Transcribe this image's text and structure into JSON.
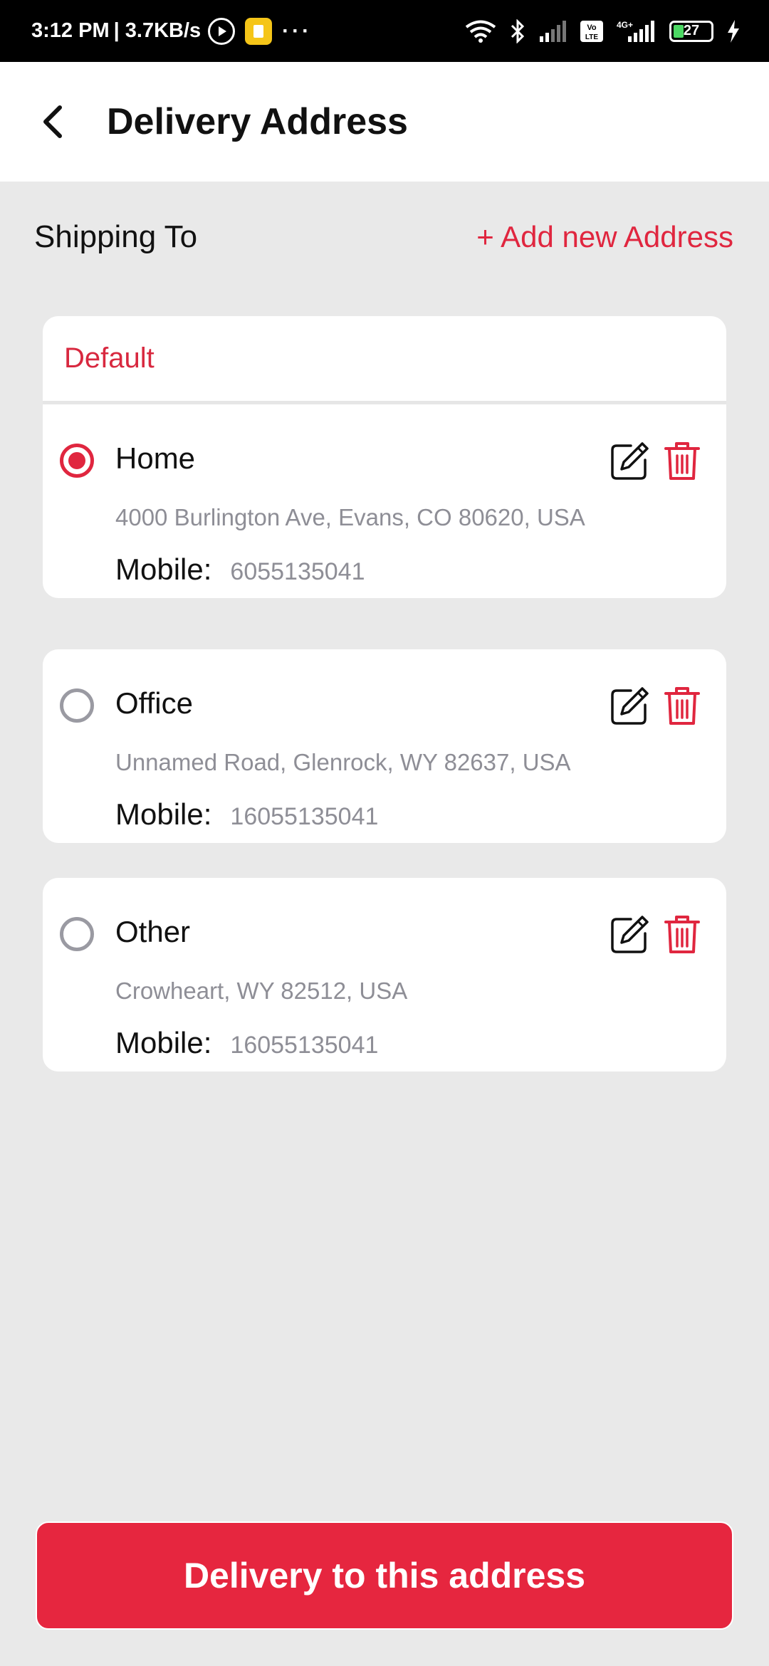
{
  "status_bar": {
    "time": "3:12 PM",
    "speed": "| 3.7KB/s",
    "dots": "···",
    "battery_level": "27",
    "icons": [
      "play-icon",
      "app-notification-icon",
      "wifi-icon",
      "bluetooth-icon",
      "signal-icon",
      "volte-icon",
      "4g-signal-icon",
      "battery-icon",
      "charging-icon"
    ]
  },
  "header": {
    "title": "Delivery Address"
  },
  "shipping": {
    "label": "Shipping To",
    "add_link": "+ Add new Address"
  },
  "default_label": "Default",
  "mobile_label": "Mobile:",
  "addresses": [
    {
      "name": "Home",
      "address": "4000 Burlington Ave, Evans, CO 80620, USA",
      "mobile": "6055135041",
      "selected": true
    },
    {
      "name": "Office",
      "address": "Unnamed Road, Glenrock, WY 82637, USA",
      "mobile": "16055135041",
      "selected": false
    },
    {
      "name": "Other",
      "address": "Crowheart, WY 82512, USA",
      "mobile": "16055135041",
      "selected": false
    }
  ],
  "colors": {
    "accent": "#e0263f",
    "background": "#e9e9e9"
  },
  "primary_button": {
    "label": "Delivery to this address"
  }
}
